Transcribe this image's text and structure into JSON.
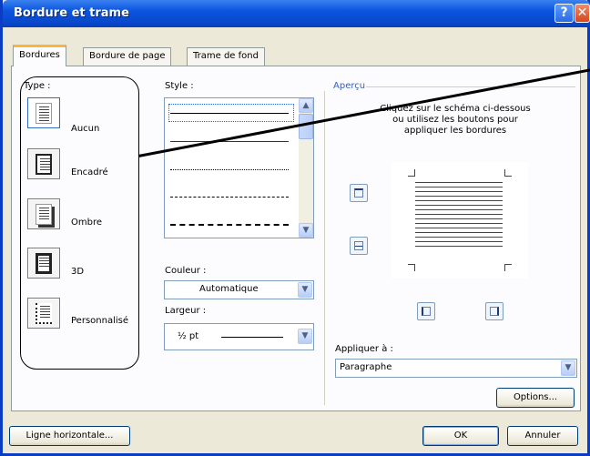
{
  "window": {
    "title": "Bordure et trame"
  },
  "tabs": [
    {
      "label": "Bordures",
      "active": true
    },
    {
      "label": "Bordure de page",
      "active": false
    },
    {
      "label": "Trame de fond",
      "active": false
    }
  ],
  "type_section": {
    "label": "Type :",
    "options": [
      {
        "label": "Aucun",
        "icon": "no-border-icon",
        "selected": true
      },
      {
        "label": "Encadré",
        "icon": "box-border-icon",
        "selected": false
      },
      {
        "label": "Ombre",
        "icon": "shadow-border-icon",
        "selected": false
      },
      {
        "label": "3D",
        "icon": "3d-border-icon",
        "selected": false
      },
      {
        "label": "Personnalisé",
        "icon": "custom-border-icon",
        "selected": false
      }
    ]
  },
  "style_section": {
    "label": "Style :",
    "line_styles": [
      "solid",
      "solid-thin",
      "dotted",
      "dashed",
      "dash-dot"
    ]
  },
  "color_section": {
    "label": "Couleur :",
    "value": "Automatique"
  },
  "width_section": {
    "label": "Largeur :",
    "value": "½ pt"
  },
  "preview": {
    "label": "Aperçu",
    "instructions_1": "Cliquez sur le schéma ci-dessous",
    "instructions_2": "ou utilisez les boutons pour",
    "instructions_3": "appliquer les bordures"
  },
  "apply_to": {
    "label": "Appliquer à :",
    "value": "Paragraphe"
  },
  "buttons": {
    "options": "Options...",
    "horizontal_line": "Ligne horizontale...",
    "ok": "OK",
    "cancel": "Annuler"
  },
  "colors": {
    "titlebar": "#0b54e0",
    "dialog_bg": "#ece9d8",
    "tab_highlight": "#f7b53b"
  }
}
